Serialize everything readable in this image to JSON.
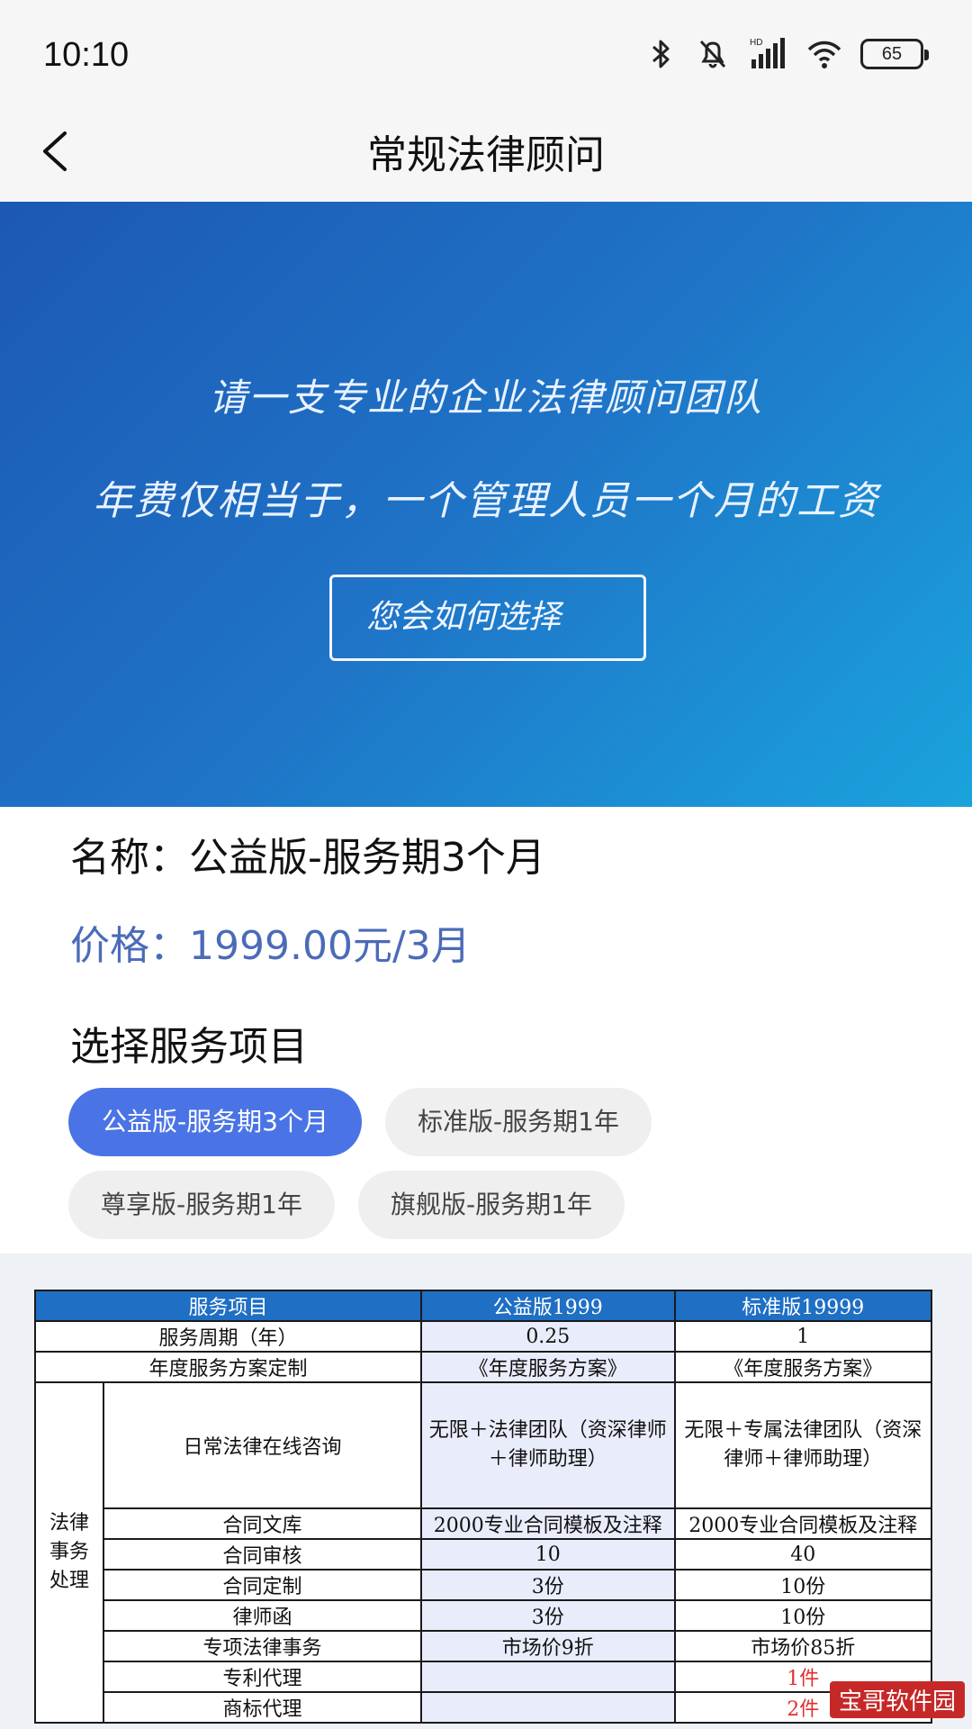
{
  "status_bar": {
    "time": "10:10",
    "battery": "65"
  },
  "navbar": {
    "title": "常规法律顾问"
  },
  "banner": {
    "line1": "请一支专业的企业法律顾问团队",
    "line2": "年费仅相当于，一个管理人员一个月的工资",
    "button": "您会如何选择"
  },
  "product": {
    "name": "名称：公益版-服务期3个月",
    "price": "价格：1999.00元/3月"
  },
  "services": {
    "title": "选择服务项目",
    "options": [
      {
        "label": "公益版-服务期3个月",
        "selected": true
      },
      {
        "label": "标准版-服务期1年",
        "selected": false
      },
      {
        "label": "尊享版-服务期1年",
        "selected": false
      },
      {
        "label": "旗舰版-服务期1年",
        "selected": false
      }
    ]
  },
  "table": {
    "headers": [
      "服务项目",
      "公益版1999",
      "标准版19999"
    ],
    "rows": [
      {
        "item": "服务周期（年）",
        "a": "0.25",
        "b": "1"
      },
      {
        "item": "年度服务方案定制",
        "a": "《年度服务方案》",
        "b": "《年度服务方案》"
      },
      {
        "item": "日常法律在线咨询",
        "a": "无限＋法律团队（资深律师＋律师助理）",
        "b": "无限＋专属法律团队（资深律师＋律师助理）"
      },
      {
        "item": "合同文库",
        "a": "2000专业合同模板及注释",
        "b": "2000专业合同模板及注释"
      },
      {
        "item": "合同审核",
        "a": "10",
        "b": "40"
      },
      {
        "item": "合同定制",
        "a": "3份",
        "b": "10份"
      },
      {
        "item": "律师函",
        "a": "3份",
        "b": "10份"
      },
      {
        "item": "专项法律事务",
        "a": "市场价9折",
        "b": "市场价85折"
      },
      {
        "item": "专利代理",
        "a": "",
        "b": "1件"
      },
      {
        "item": "商标代理",
        "a": "",
        "b": "2件"
      }
    ],
    "group_label": "法律事务处理"
  },
  "watermark": "宝哥软件园",
  "colors": {
    "accent": "#4a74e6",
    "price": "#4b6bb9",
    "table_header": "#1f6fc4"
  }
}
